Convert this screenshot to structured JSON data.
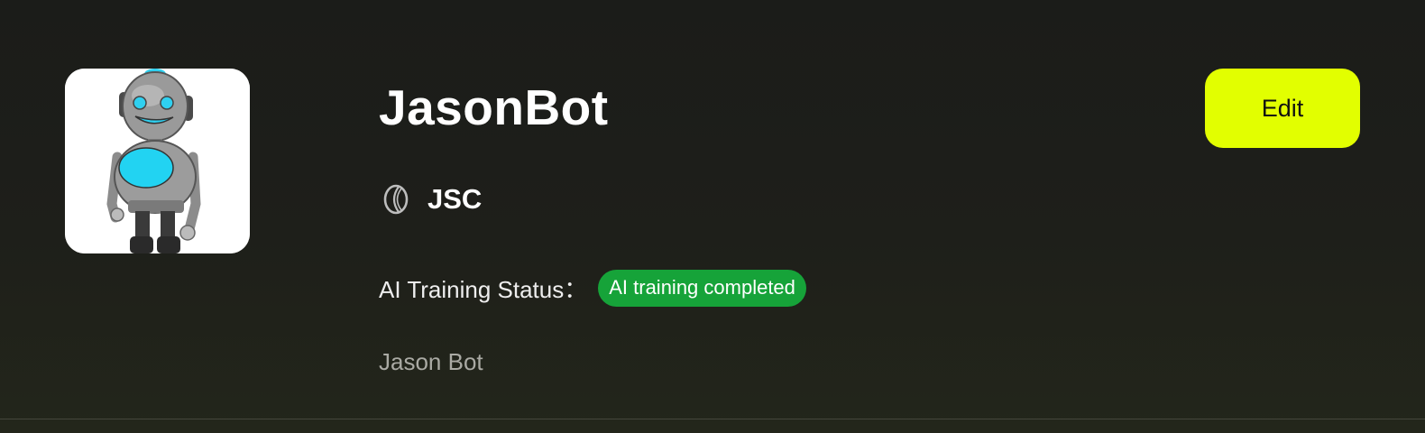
{
  "profile": {
    "avatar_icon": "robot-avatar",
    "name": "JasonBot",
    "token_icon": "coin-icon",
    "token_symbol": "JSC",
    "status_label": "AI Training Status：",
    "status_value": "AI training completed",
    "description": "Jason Bot"
  },
  "actions": {
    "edit_label": "Edit"
  },
  "colors": {
    "background": "#1d1e1a",
    "accent": "#e2ff00",
    "status_success": "#16a339",
    "muted_text": "#aaaaa4"
  }
}
